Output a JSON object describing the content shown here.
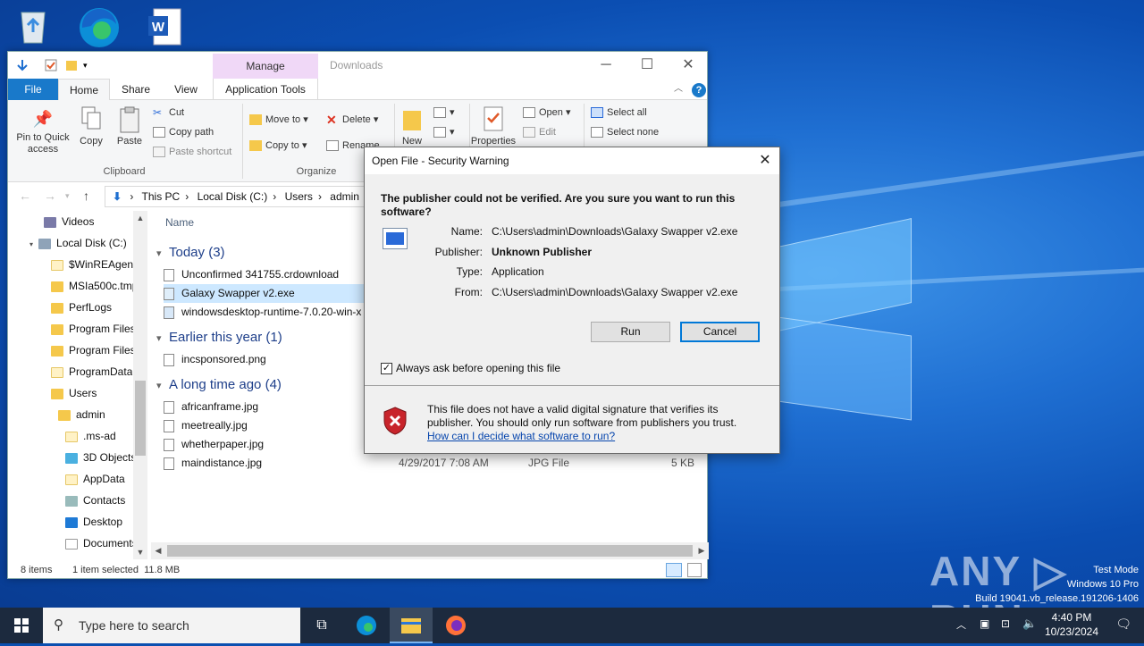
{
  "explorer": {
    "title": "Downloads",
    "manage_tab": "Manage",
    "tabs": [
      "File",
      "Home",
      "Share",
      "View",
      "Application Tools"
    ],
    "ribbon": {
      "pin_label": "Pin to Quick access",
      "copy_label": "Copy",
      "paste_label": "Paste",
      "cut_label": "Cut",
      "copy_path_label": "Copy path",
      "paste_shortcut_label": "Paste shortcut",
      "clipboard_group": "Clipboard",
      "move_to_label": "Move to",
      "copy_to_label": "Copy to",
      "delete_label": "Delete",
      "rename_label": "Rename",
      "organize_group": "Organize",
      "new_label": "New",
      "properties_label": "Properties",
      "open_label": "Open",
      "edit_label": "Edit",
      "select_all_label": "Select all",
      "select_none_label": "Select none"
    },
    "breadcrumb": [
      "This PC",
      "Local Disk (C:)",
      "Users",
      "admin"
    ],
    "nav_items": [
      "Videos",
      "Local Disk (C:)",
      "$WinREAgent",
      "MSIa500c.tmp",
      "PerfLogs",
      "Program Files",
      "Program Files",
      "ProgramData",
      "Users",
      "admin",
      ".ms-ad",
      "3D Objects",
      "AppData",
      "Contacts",
      "Desktop",
      "Documents"
    ],
    "column_name": "Name",
    "groups": [
      {
        "label": "Today (3)",
        "files": [
          "Unconfirmed 341755.crdownload",
          "Galaxy Swapper v2.exe",
          "windowsdesktop-runtime-7.0.20-win-x"
        ]
      },
      {
        "label": "Earlier this year (1)",
        "files": [
          "incsponsored.png"
        ]
      },
      {
        "label": "A long time ago (4)",
        "files": [
          "africanframe.jpg",
          "meetreally.jpg",
          "whetherpaper.jpg",
          "maindistance.jpg"
        ]
      }
    ],
    "last_row": {
      "date": "4/29/2017 7:08 AM",
      "type": "JPG File",
      "size": "5 KB"
    },
    "status": {
      "count": "8 items",
      "selected": "1 item selected  11.8 MB"
    }
  },
  "dialog": {
    "title": "Open File - Security Warning",
    "question": "The publisher could not be verified.  Are you sure you want to run this software?",
    "name_label": "Name:",
    "name_value": "C:\\Users\\admin\\Downloads\\Galaxy Swapper v2.exe",
    "publisher_label": "Publisher:",
    "publisher_value": "Unknown Publisher",
    "type_label": "Type:",
    "type_value": "Application",
    "from_label": "From:",
    "from_value": "C:\\Users\\admin\\Downloads\\Galaxy Swapper v2.exe",
    "run_label": "Run",
    "cancel_label": "Cancel",
    "checkbox_label": "Always ask before opening this file",
    "warning_text": "This file does not have a valid digital signature that verifies its publisher.  You should only run software from publishers you trust.",
    "link_text": "How can I decide what software to run?"
  },
  "taskbar": {
    "search_placeholder": "Type here to search",
    "time": "4:40 PM",
    "date": "10/23/2024"
  },
  "watermark": {
    "line1": "Test Mode",
    "line2": "Windows 10 Pro",
    "line3": "Build 19041.vb_release.191206-1406",
    "brand": "ANY RUN"
  }
}
